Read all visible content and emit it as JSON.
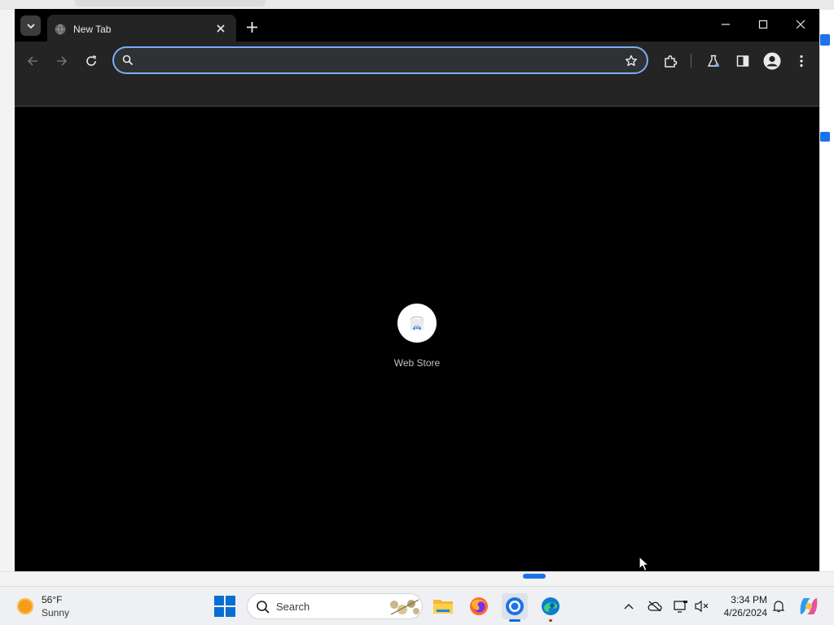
{
  "browser": {
    "tab": {
      "title": "New Tab"
    },
    "omnibox": {
      "value": "",
      "placeholder": ""
    }
  },
  "newtab": {
    "shortcuts": [
      {
        "label": "Web Store"
      }
    ]
  },
  "taskbar": {
    "weather": {
      "temp": "56°F",
      "desc": "Sunny"
    },
    "search_label": "Search",
    "clock": {
      "time": "3:34 PM",
      "date": "4/26/2024"
    }
  },
  "colors": {
    "accent": "#7cacf8",
    "window_bg": "#000000",
    "toolbar_bg": "#242424",
    "taskbar_bg": "#eef0f3"
  },
  "icons": [
    "tab-search-icon",
    "globe-icon",
    "close-icon",
    "plus-icon",
    "minimize-icon",
    "maximize-icon",
    "back-arrow-icon",
    "forward-arrow-icon",
    "reload-icon",
    "search-icon",
    "star-icon",
    "extensions-icon",
    "labs-flask-icon",
    "side-panel-icon",
    "profile-icon",
    "more-vert-icon",
    "web-store-icon",
    "windows-logo-icon",
    "file-explorer-icon",
    "firefox-icon",
    "chrome-icon",
    "edge-icon",
    "chevron-up-icon",
    "onedrive-offline-icon",
    "display-icon",
    "volume-muted-icon",
    "bell-icon",
    "copilot-icon"
  ]
}
